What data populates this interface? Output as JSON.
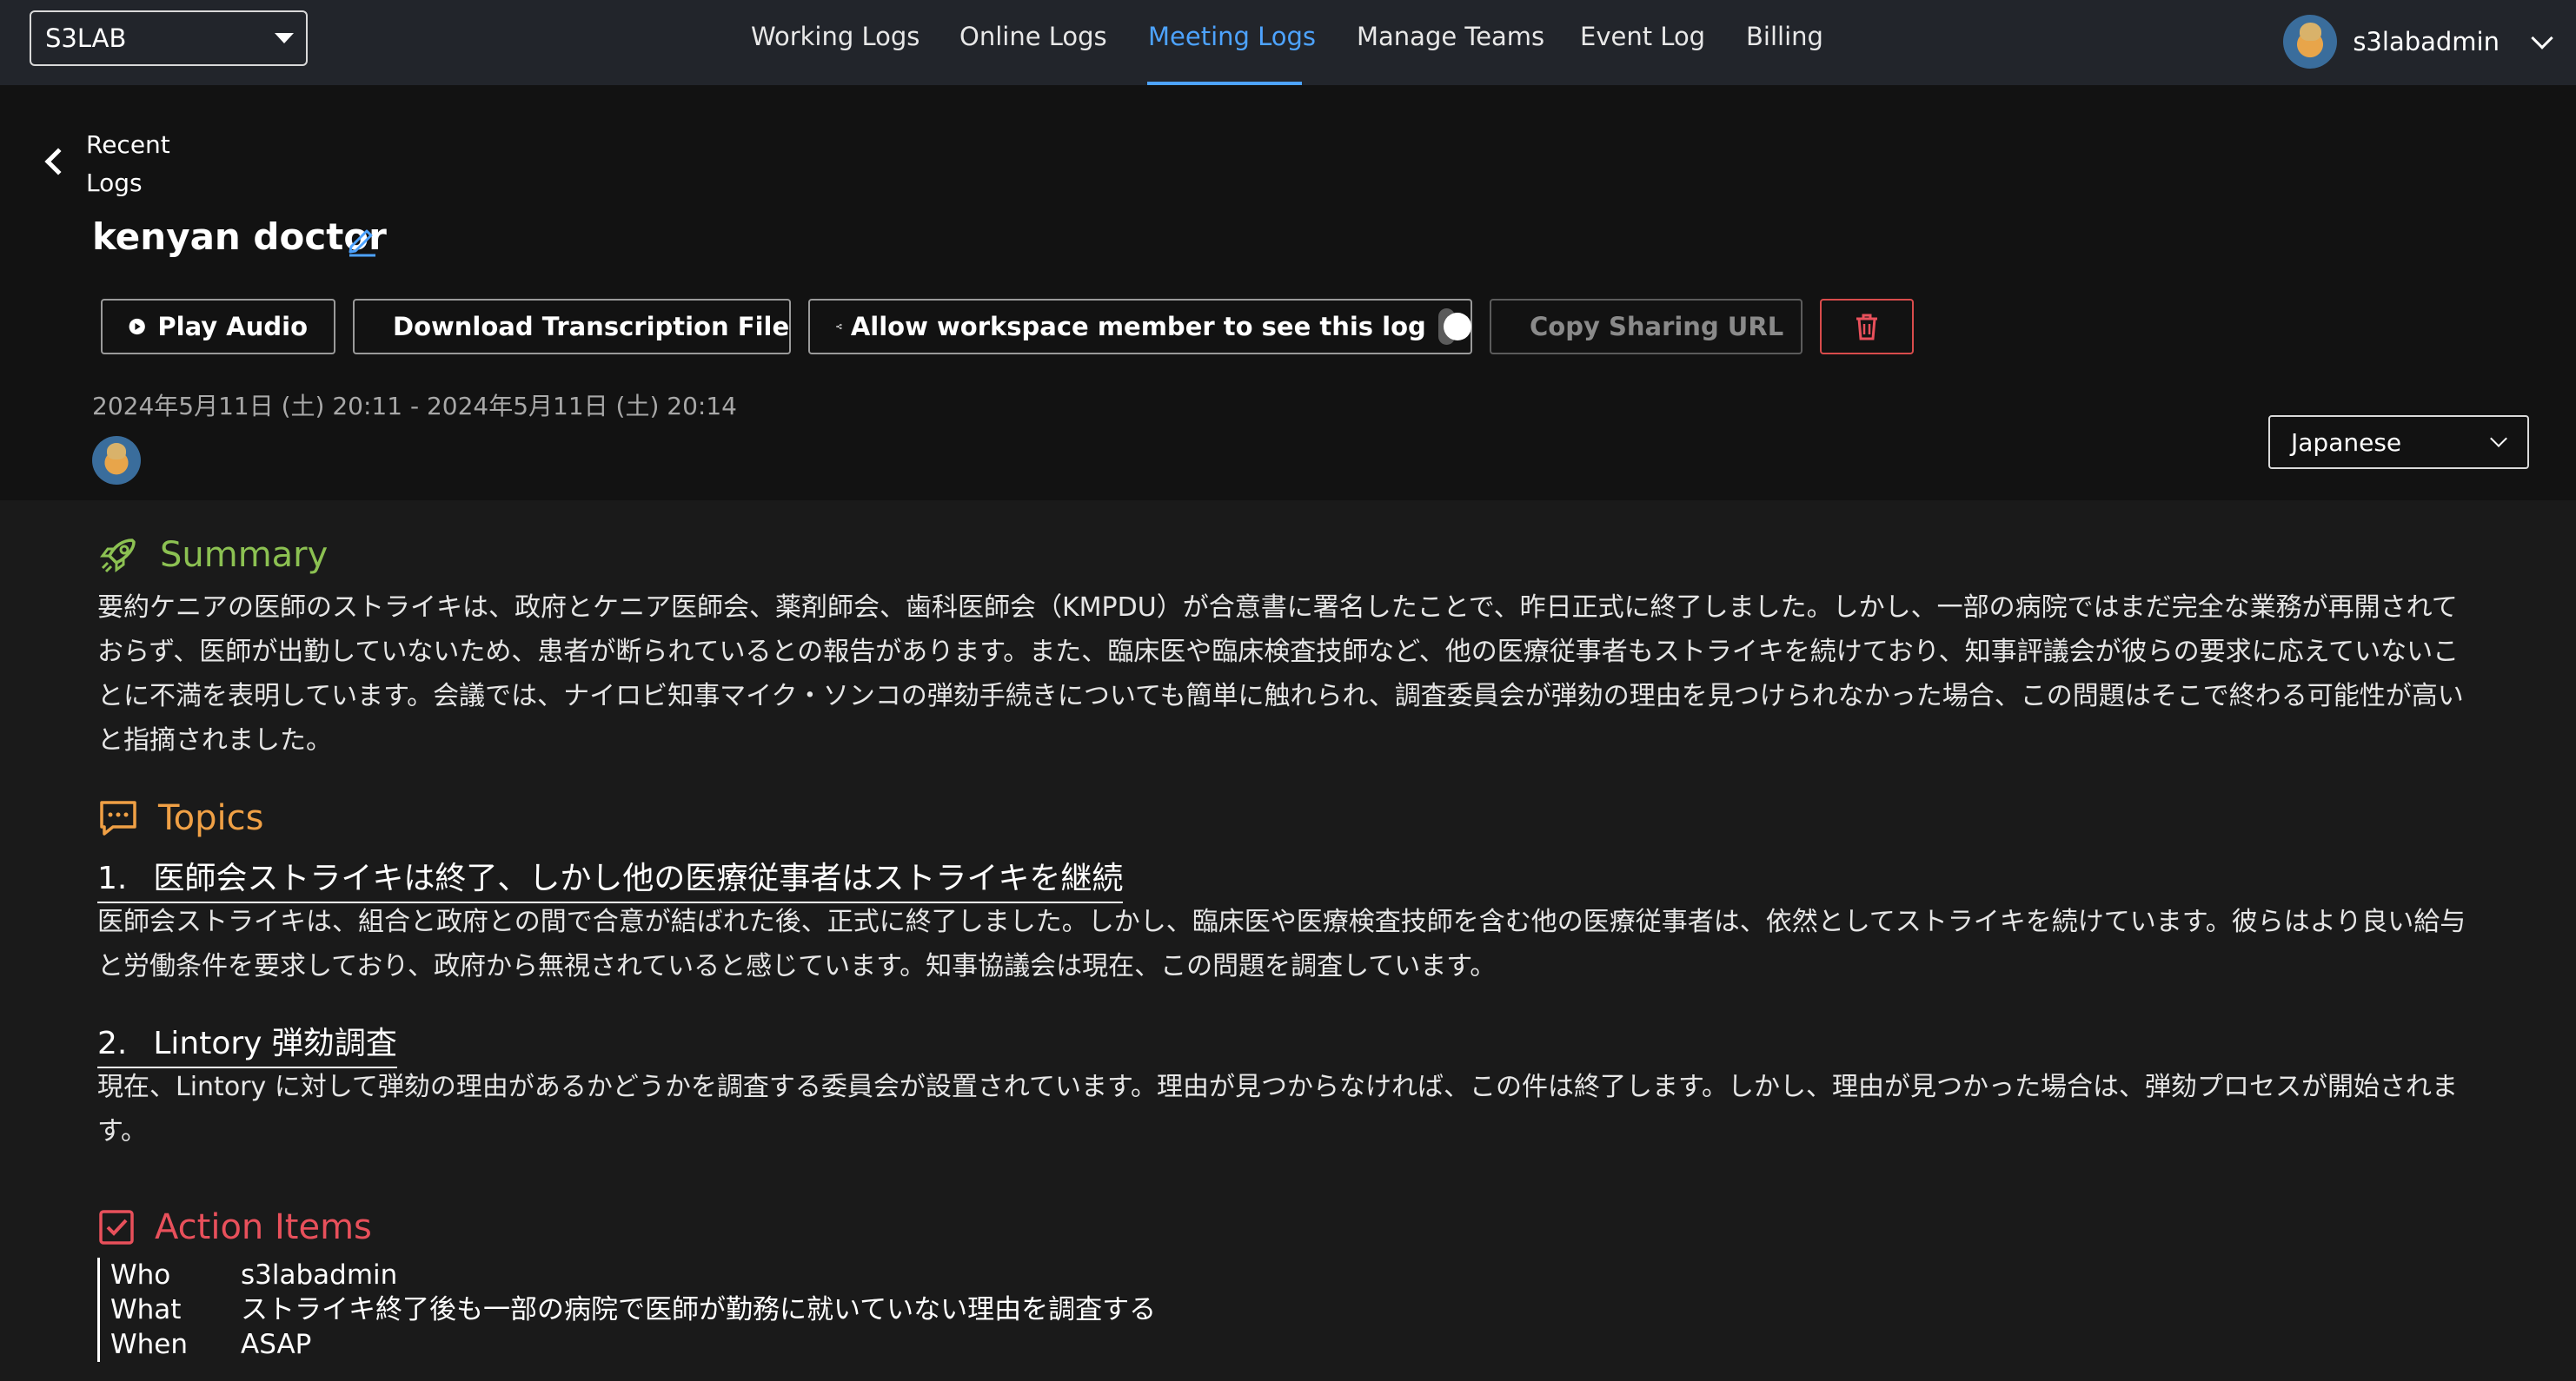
{
  "workspace": {
    "selected": "S3LAB"
  },
  "nav": {
    "items": [
      {
        "label": "Working Logs",
        "active": false
      },
      {
        "label": "Online Logs",
        "active": false
      },
      {
        "label": "Meeting Logs",
        "active": true
      },
      {
        "label": "Manage Teams",
        "active": false
      },
      {
        "label": "Event Log",
        "active": false
      },
      {
        "label": "Billing",
        "active": false
      }
    ]
  },
  "user": {
    "name": "s3labadmin",
    "avatar_icon": "user-avatar"
  },
  "back": {
    "label": "Recent Logs"
  },
  "log": {
    "title": "kenyan doctor",
    "date_range": "2024年5月11日 (土) 20:11 - 2024年5月11日 (土) 20:14"
  },
  "toolbar": {
    "play_label": "Play Audio",
    "download_label": "Download Transcription File",
    "share_toggle_label": "Allow workspace member to see this log",
    "share_toggle_on": false,
    "copy_url_label": "Copy Sharing URL",
    "delete_icon": "trash-icon"
  },
  "language": {
    "selected": "Japanese"
  },
  "summary": {
    "heading": "Summary",
    "text": "要約ケニアの医師のストライキは、政府とケニア医師会、薬剤師会、歯科医師会（KMPDU）が合意書に署名したことで、昨日正式に終了しました。しかし、一部の病院ではまだ完全な業務が再開されておらず、医師が出勤していないため、患者が断られているとの報告があります。また、臨床医や臨床検査技師など、他の医療従事者もストライキを続けており、知事評議会が彼らの要求に応えていないことに不満を表明しています。会議では、ナイロビ知事マイク・ソンコの弾劾手続きについても簡単に触れられ、調査委員会が弾劾の理由を見つけられなかった場合、この問題はそこで終わる可能性が高いと指摘されました。"
  },
  "topics": {
    "heading": "Topics",
    "items": [
      {
        "num": "1.",
        "title": "医師会ストライキは終了、しかし他の医療従事者はストライキを継続",
        "text": "医師会ストライキは、組合と政府との間で合意が結ばれた後、正式に終了しました。しかし、臨床医や医療検査技師を含む他の医療従事者は、依然としてストライキを続けています。彼らはより良い給与と労働条件を要求しており、政府から無視されていると感じています。知事協議会は現在、この問題を調査しています。"
      },
      {
        "num": "2.",
        "title": "Lintory 弾劾調査",
        "text": "現在、Lintory に対して弾劾の理由があるかどうかを調査する委員会が設置されています。理由が見つからなければ、この件は終了します。しかし、理由が見つかった場合は、弾劾プロセスが開始されます。"
      }
    ]
  },
  "action_items": {
    "heading": "Action Items",
    "rows": [
      {
        "key": "Who",
        "value": "s3labadmin"
      },
      {
        "key": "What",
        "value": "ストライキ終了後も一部の病院で医師が勤務に就いていない理由を調査する"
      },
      {
        "key": "When",
        "value": "ASAP"
      }
    ]
  },
  "colors": {
    "accent": "#4da3ff",
    "summary": "#8cc152",
    "topics": "#f0a045",
    "actions": "#e8505b",
    "danger": "#d94c4c"
  }
}
